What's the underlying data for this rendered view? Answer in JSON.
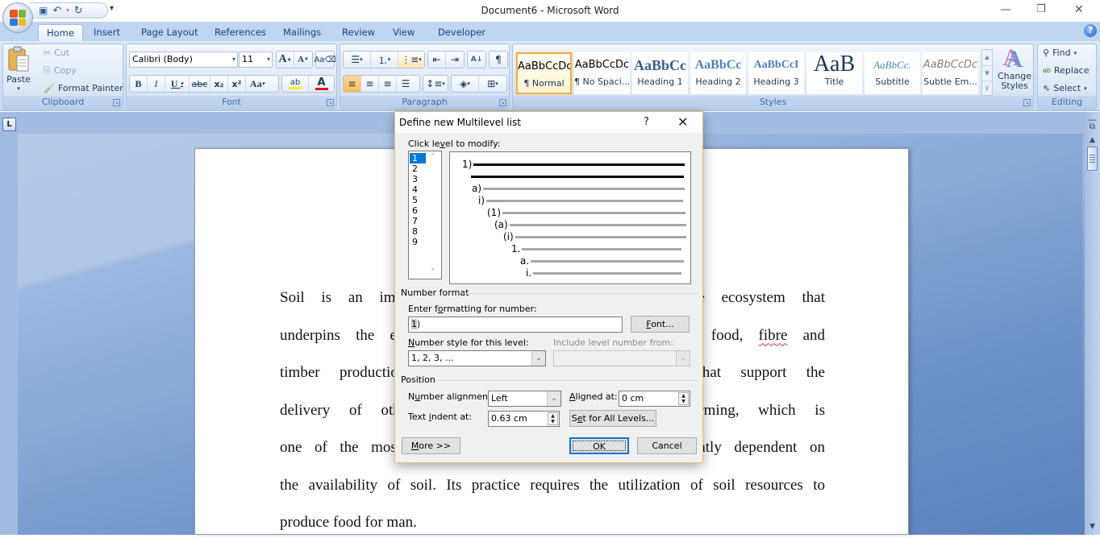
{
  "window": {
    "title": "Document6 - Microsoft Word",
    "controls": {
      "minimize": "—",
      "restore": "❐",
      "close": "✕"
    }
  },
  "qat": {
    "save_icon": "💾",
    "undo_icon": "↶",
    "redo_icon": "↻",
    "more_icon": "▾"
  },
  "tabs": [
    {
      "label": "Home",
      "active": true
    },
    {
      "label": "Insert"
    },
    {
      "label": "Page Layout"
    },
    {
      "label": "References"
    },
    {
      "label": "Mailings"
    },
    {
      "label": "Review"
    },
    {
      "label": "View"
    },
    {
      "label": "Developer"
    }
  ],
  "ribbon": {
    "clipboard": {
      "label": "Clipboard",
      "paste": "Paste",
      "cut": "Cut",
      "copy": "Copy",
      "format_painter": "Format Painter"
    },
    "font": {
      "label": "Font",
      "font_name": "Calibri (Body)",
      "font_size": "11",
      "grow": "A",
      "shrink": "A",
      "bold": "B",
      "italic": "I",
      "underline": "U",
      "strike": "abc",
      "subscript": "x₂",
      "superscript": "x²",
      "change_case": "Aa",
      "highlight": "ab",
      "font_color": "A",
      "font_color_hex": "#e81123",
      "highlight_hex": "#f5ef2d"
    },
    "paragraph": {
      "label": "Paragraph"
    },
    "styles": {
      "label": "Styles",
      "items": [
        {
          "sample": "AaBbCcDc",
          "name": "¶ Normal",
          "active": true
        },
        {
          "sample": "AaBbCcDc",
          "name": "¶ No Spaci..."
        },
        {
          "sample": "AaBbCc",
          "name": "Heading 1"
        },
        {
          "sample": "AaBbCc",
          "name": "Heading 2"
        },
        {
          "sample": "AaBbCcI",
          "name": "Heading 3"
        },
        {
          "sample": "AaB",
          "name": "Title"
        },
        {
          "sample": "AaBbCc.",
          "name": "Subtitle"
        },
        {
          "sample": "AaBbCcDc",
          "name": "Subtle Em..."
        }
      ],
      "change_styles": "Change Styles"
    },
    "editing": {
      "label": "Editing",
      "find": "Find",
      "replace": "Replace",
      "select": "Select"
    }
  },
  "document": {
    "lines": [
      "Soil is an impor",
      "underpins the exi",
      "timber productio",
      "delivery of other",
      "one of the most i",
      "the availability of soil. Its practice requires the utilization of soil resources to",
      "produce food for man."
    ],
    "right_fragments": [
      "he ecosystem that",
      "of food, fibre and",
      "s that support the",
      "farming, which is",
      "eatly dependent on"
    ],
    "misspelled": "fibre"
  },
  "dialog": {
    "title": "Define new Multilevel list",
    "help": "?",
    "close": "✕",
    "click_level_label": "Click level to modify:",
    "levels": [
      "1",
      "2",
      "3",
      "4",
      "5",
      "6",
      "7",
      "8",
      "9"
    ],
    "selected_level": "1",
    "preview_numbers": [
      "1)",
      "",
      "a)",
      "i)",
      "(1)",
      "(a)",
      "(i)",
      "1.",
      "a.",
      "i."
    ],
    "number_format_section": "Number format",
    "enter_formatting_label": "Enter formatting for number:",
    "formatting_value_highlight": "1",
    "formatting_value_rest": ")",
    "font_button": "Font...",
    "number_style_label": "Number style for this level:",
    "number_style_value": "1, 2, 3, ...",
    "include_level_label": "Include level number from:",
    "include_level_value": "",
    "position_section": "Position",
    "number_alignment_label": "Number alignment:",
    "number_alignment_value": "Left",
    "aligned_at_label": "Aligned at:",
    "aligned_at_value": "0 cm",
    "text_indent_label": "Text indent at:",
    "text_indent_value": "0.63 cm",
    "set_all_levels": "Set for All Levels...",
    "more_button": "More >>",
    "ok_button": "OK",
    "cancel_button": "Cancel"
  }
}
